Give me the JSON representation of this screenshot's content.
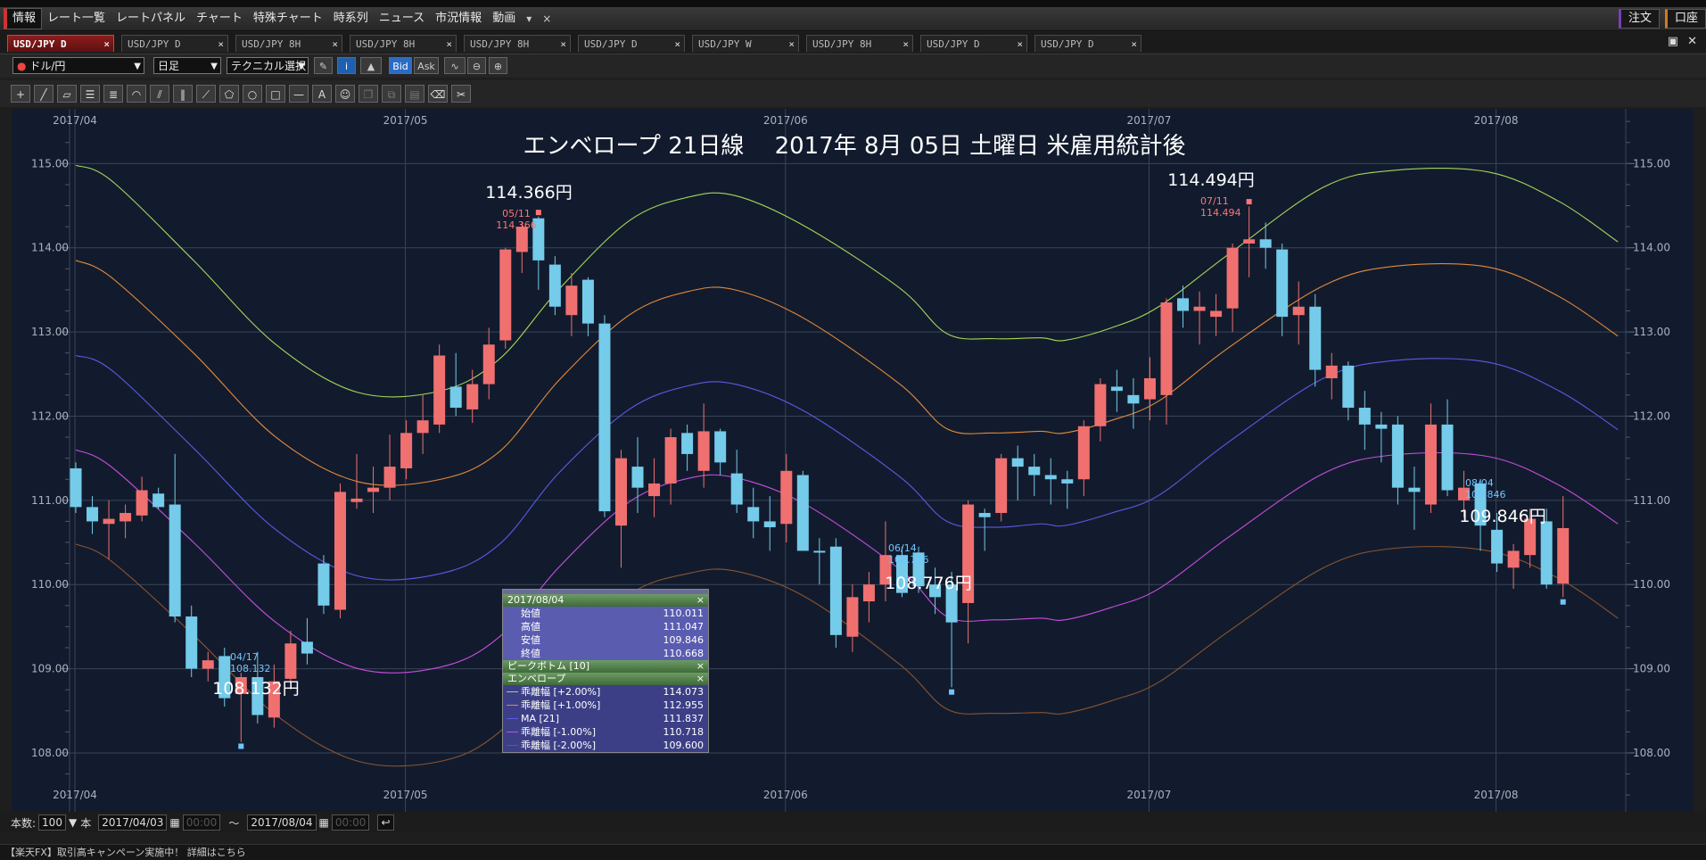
{
  "menubar": {
    "items": [
      "情報",
      "レート一覧",
      "レートパネル",
      "チャート",
      "特殊チャート",
      "時系列",
      "ニュース",
      "市況情報",
      "動画"
    ],
    "right": {
      "order": "注文",
      "account": "口座"
    }
  },
  "tabs": [
    "USD/JPY D",
    "USD/JPY D",
    "USD/JPY 8H",
    "USD/JPY 8H",
    "USD/JPY 8H",
    "USD/JPY D",
    "USD/JPY W",
    "USD/JPY 8H",
    "USD/JPY D",
    "USD/JPY D"
  ],
  "toolbar": {
    "symbol": "ドル/円",
    "timeframe": "日足",
    "technical": "テクニカル選択",
    "bid": "Bid",
    "ask": "Ask"
  },
  "chart_title": "エンベロープ 21日線　 2017年 8月 05日 土曜日 米雇用統計後",
  "annotations": {
    "may_high": "114.366円",
    "jul_high": "114.494円",
    "apr_low": "108.132円",
    "jun_low": "108.776円",
    "aug_last": "109.846円"
  },
  "markers": {
    "may_high_date": "05/11",
    "may_high_val": "114.366",
    "jul_high_date": "07/11",
    "jul_high_val": "114.494",
    "apr_low_date": "04/17",
    "apr_low_val": "108.132",
    "jun_low_date": "06/14",
    "jun_low_val": "108.776",
    "aug_date": "08/04",
    "aug_val": "109.846"
  },
  "tooltip": {
    "date": "2017/08/04",
    "ohlc": [
      {
        "label": "始値",
        "value": "110.011"
      },
      {
        "label": "高値",
        "value": "111.047"
      },
      {
        "label": "安値",
        "value": "109.846"
      },
      {
        "label": "終値",
        "value": "110.668"
      }
    ],
    "section1": "ピークボトム [10]",
    "section2": "エンベロープ",
    "env": [
      {
        "label": "乖離幅 [+2.00%]",
        "value": "114.073",
        "color": "#a5d65b"
      },
      {
        "label": "乖離幅 [+1.00%]",
        "value": "112.955",
        "color": "#e38a3a"
      },
      {
        "label": "MA [21]",
        "value": "111.837",
        "color": "#5a5ae6"
      },
      {
        "label": "乖離幅 [-1.00%]",
        "value": "110.718",
        "color": "#c64ee0"
      },
      {
        "label": "乖離幅 [-2.00%]",
        "value": "109.600",
        "color": "#8a5430"
      }
    ]
  },
  "bottom": {
    "count_label": "本数:",
    "count": "100",
    "unit": "本",
    "from": "2017/04/03",
    "time_placeholder": "00:00",
    "to": "2017/08/04",
    "tilde": "～"
  },
  "status": "【楽天FX】取引高キャンペーン実施中！ 詳細はこちら",
  "chart_data": {
    "type": "candlestick",
    "title": "エンベロープ 21日線　 2017年 8月 05日 土曜日 米雇用統計後",
    "y_ticks": [
      "115.00",
      "114.00",
      "113.00",
      "112.00",
      "111.00",
      "110.00",
      "109.00",
      "108.00"
    ],
    "ylim": [
      107.3,
      115.65
    ],
    "x_ticks": [
      {
        "label": "2017/04",
        "day": 0
      },
      {
        "label": "2017/05",
        "day": 20
      },
      {
        "label": "2017/06",
        "day": 43
      },
      {
        "label": "2017/07",
        "day": 65
      },
      {
        "label": "2017/08",
        "day": 86
      }
    ],
    "colors": {
      "up": "#f07070",
      "down": "#74cbea"
    },
    "candles": [
      [
        111.38,
        111.45,
        110.85,
        110.92
      ],
      [
        110.92,
        111.05,
        110.6,
        110.75
      ],
      [
        110.72,
        111.0,
        110.3,
        110.78
      ],
      [
        110.75,
        110.95,
        110.55,
        110.85
      ],
      [
        110.82,
        111.28,
        110.75,
        111.12
      ],
      [
        111.08,
        111.15,
        110.9,
        110.92
      ],
      [
        110.95,
        111.55,
        109.55,
        109.62
      ],
      [
        109.62,
        109.75,
        108.9,
        109.0
      ],
      [
        109.0,
        109.2,
        108.85,
        109.1
      ],
      [
        109.15,
        109.25,
        108.55,
        108.65
      ],
      [
        108.7,
        108.95,
        108.13,
        108.9
      ],
      [
        108.9,
        109.2,
        108.35,
        108.45
      ],
      [
        108.42,
        109.05,
        108.3,
        108.85
      ],
      [
        108.88,
        109.45,
        108.75,
        109.3
      ],
      [
        109.32,
        109.6,
        109.05,
        109.18
      ],
      [
        110.25,
        110.35,
        109.65,
        109.75
      ],
      [
        109.7,
        111.2,
        109.6,
        111.1
      ],
      [
        110.98,
        111.55,
        110.9,
        111.02
      ],
      [
        111.1,
        111.4,
        110.85,
        111.15
      ],
      [
        111.15,
        111.78,
        111.0,
        111.4
      ],
      [
        111.38,
        111.95,
        111.25,
        111.8
      ],
      [
        111.8,
        112.25,
        111.55,
        111.95
      ],
      [
        111.9,
        112.85,
        111.8,
        112.72
      ],
      [
        112.35,
        112.75,
        112.0,
        112.1
      ],
      [
        112.08,
        112.55,
        111.92,
        112.38
      ],
      [
        112.38,
        113.05,
        112.2,
        112.85
      ],
      [
        112.9,
        114.0,
        112.8,
        113.98
      ],
      [
        113.95,
        114.3,
        113.7,
        114.25
      ],
      [
        114.35,
        114.37,
        113.5,
        113.85
      ],
      [
        113.8,
        113.9,
        113.2,
        113.3
      ],
      [
        113.2,
        113.7,
        112.95,
        113.55
      ],
      [
        113.62,
        113.65,
        112.95,
        113.1
      ],
      [
        113.1,
        113.2,
        110.8,
        110.87
      ],
      [
        110.7,
        111.6,
        110.2,
        111.5
      ],
      [
        111.4,
        111.75,
        110.85,
        111.15
      ],
      [
        111.05,
        111.5,
        110.8,
        111.2
      ],
      [
        111.2,
        111.85,
        110.95,
        111.75
      ],
      [
        111.8,
        111.9,
        111.35,
        111.55
      ],
      [
        111.35,
        112.15,
        111.15,
        111.82
      ],
      [
        111.82,
        111.85,
        111.3,
        111.45
      ],
      [
        111.32,
        111.6,
        110.85,
        110.95
      ],
      [
        110.92,
        111.15,
        110.55,
        110.75
      ],
      [
        110.75,
        111.05,
        110.4,
        110.68
      ],
      [
        110.72,
        111.55,
        110.5,
        111.35
      ],
      [
        111.3,
        111.35,
        110.4,
        110.4
      ],
      [
        110.4,
        110.55,
        110.0,
        110.38
      ],
      [
        110.45,
        110.55,
        109.25,
        109.4
      ],
      [
        109.38,
        110.0,
        109.2,
        109.85
      ],
      [
        109.8,
        110.15,
        109.55,
        110.0
      ],
      [
        110.0,
        110.75,
        109.8,
        110.35
      ],
      [
        110.35,
        110.45,
        109.85,
        109.9
      ],
      [
        110.38,
        110.45,
        109.9,
        109.98
      ],
      [
        110.0,
        110.2,
        109.65,
        109.85
      ],
      [
        110.0,
        110.15,
        108.78,
        109.55
      ],
      [
        109.78,
        111.0,
        109.3,
        110.95
      ],
      [
        110.85,
        110.9,
        110.4,
        110.8
      ],
      [
        110.85,
        111.55,
        110.75,
        111.5
      ],
      [
        111.5,
        111.65,
        111.0,
        111.4
      ],
      [
        111.4,
        111.55,
        111.05,
        111.3
      ],
      [
        111.3,
        111.5,
        110.95,
        111.25
      ],
      [
        111.25,
        111.35,
        110.9,
        111.2
      ],
      [
        111.25,
        111.95,
        111.05,
        111.88
      ],
      [
        111.88,
        112.45,
        111.7,
        112.38
      ],
      [
        112.35,
        112.55,
        112.05,
        112.3
      ],
      [
        112.25,
        112.45,
        111.85,
        112.15
      ],
      [
        112.2,
        112.7,
        111.95,
        112.45
      ],
      [
        112.25,
        113.4,
        111.9,
        113.35
      ],
      [
        113.4,
        113.55,
        113.05,
        113.25
      ],
      [
        113.25,
        113.48,
        112.85,
        113.3
      ],
      [
        113.18,
        113.45,
        112.95,
        113.25
      ],
      [
        113.28,
        114.05,
        113.0,
        114.0
      ],
      [
        114.05,
        114.49,
        113.65,
        114.1
      ],
      [
        114.1,
        114.3,
        113.75,
        114.0
      ],
      [
        113.98,
        114.05,
        112.95,
        113.18
      ],
      [
        113.2,
        113.6,
        112.85,
        113.3
      ],
      [
        113.3,
        113.45,
        112.35,
        112.55
      ],
      [
        112.45,
        112.75,
        112.2,
        112.6
      ],
      [
        112.6,
        112.65,
        111.95,
        112.1
      ],
      [
        112.1,
        112.3,
        111.6,
        111.9
      ],
      [
        111.9,
        112.05,
        111.45,
        111.85
      ],
      [
        111.9,
        112.0,
        110.95,
        111.15
      ],
      [
        111.15,
        111.4,
        110.65,
        111.1
      ],
      [
        110.95,
        112.15,
        110.85,
        111.9
      ],
      [
        111.9,
        112.2,
        111.05,
        111.12
      ],
      [
        111.0,
        111.35,
        110.8,
        111.15
      ],
      [
        111.2,
        111.25,
        110.4,
        110.7
      ],
      [
        110.65,
        110.85,
        110.15,
        110.25
      ],
      [
        110.2,
        110.48,
        109.95,
        110.4
      ],
      [
        110.35,
        110.9,
        110.2,
        110.78
      ],
      [
        110.75,
        110.9,
        109.95,
        110.0
      ],
      [
        110.01,
        111.05,
        109.85,
        110.67
      ]
    ],
    "series": [
      {
        "name": "乖離幅 [+2.00%]",
        "color": "#a5d65b",
        "values": [
          [
            0,
            114.98
          ],
          [
            3,
            114.8
          ],
          [
            10,
            113.85
          ],
          [
            17,
            112.85
          ],
          [
            24,
            112.28
          ],
          [
            31,
            112.3
          ],
          [
            36,
            112.68
          ],
          [
            41,
            113.5
          ],
          [
            47,
            114.32
          ],
          [
            52,
            114.6
          ],
          [
            56,
            114.62
          ],
          [
            62,
            114.25
          ],
          [
            70,
            113.52
          ],
          [
            74,
            112.98
          ],
          [
            78,
            112.92
          ],
          [
            82,
            112.93
          ],
          [
            84,
            112.9
          ],
          [
            88,
            113.05
          ],
          [
            92,
            113.3
          ],
          [
            98,
            113.93
          ],
          [
            106,
            114.72
          ],
          [
            112,
            114.92
          ],
          [
            120,
            114.9
          ],
          [
            126,
            114.55
          ],
          [
            131,
            114.07
          ]
        ]
      },
      {
        "name": "乖離幅 [+1.00%]",
        "color": "#e38a3a",
        "values": [
          [
            0,
            113.85
          ],
          [
            3,
            113.65
          ],
          [
            10,
            112.75
          ],
          [
            17,
            111.75
          ],
          [
            24,
            111.22
          ],
          [
            31,
            111.25
          ],
          [
            36,
            111.58
          ],
          [
            41,
            112.42
          ],
          [
            47,
            113.2
          ],
          [
            52,
            113.48
          ],
          [
            56,
            113.5
          ],
          [
            62,
            113.15
          ],
          [
            70,
            112.38
          ],
          [
            74,
            111.85
          ],
          [
            78,
            111.8
          ],
          [
            82,
            111.82
          ],
          [
            84,
            111.8
          ],
          [
            88,
            111.95
          ],
          [
            92,
            112.18
          ],
          [
            98,
            112.82
          ],
          [
            106,
            113.55
          ],
          [
            112,
            113.78
          ],
          [
            120,
            113.77
          ],
          [
            126,
            113.42
          ],
          [
            131,
            112.95
          ]
        ]
      },
      {
        "name": "MA [21]",
        "color": "#5a5ae6",
        "values": [
          [
            0,
            112.72
          ],
          [
            3,
            112.55
          ],
          [
            10,
            111.62
          ],
          [
            17,
            110.65
          ],
          [
            24,
            110.1
          ],
          [
            31,
            110.13
          ],
          [
            36,
            110.48
          ],
          [
            41,
            111.32
          ],
          [
            47,
            112.08
          ],
          [
            52,
            112.36
          ],
          [
            56,
            112.38
          ],
          [
            62,
            112.05
          ],
          [
            70,
            111.28
          ],
          [
            74,
            110.75
          ],
          [
            78,
            110.68
          ],
          [
            82,
            110.72
          ],
          [
            84,
            110.7
          ],
          [
            88,
            110.85
          ],
          [
            92,
            111.06
          ],
          [
            98,
            111.7
          ],
          [
            106,
            112.45
          ],
          [
            112,
            112.66
          ],
          [
            120,
            112.64
          ],
          [
            126,
            112.3
          ],
          [
            131,
            111.84
          ]
        ]
      },
      {
        "name": "乖離幅 [-1.00%]",
        "color": "#c64ee0",
        "values": [
          [
            0,
            111.6
          ],
          [
            3,
            111.4
          ],
          [
            10,
            110.5
          ],
          [
            17,
            109.55
          ],
          [
            24,
            109.0
          ],
          [
            31,
            109.02
          ],
          [
            36,
            109.38
          ],
          [
            41,
            110.2
          ],
          [
            47,
            110.98
          ],
          [
            52,
            111.26
          ],
          [
            56,
            111.27
          ],
          [
            62,
            110.95
          ],
          [
            70,
            110.18
          ],
          [
            74,
            109.62
          ],
          [
            78,
            109.58
          ],
          [
            82,
            109.6
          ],
          [
            84,
            109.58
          ],
          [
            88,
            109.73
          ],
          [
            92,
            109.95
          ],
          [
            98,
            110.57
          ],
          [
            106,
            111.32
          ],
          [
            112,
            111.54
          ],
          [
            120,
            111.52
          ],
          [
            126,
            111.18
          ],
          [
            131,
            110.72
          ]
        ]
      },
      {
        "name": "乖離幅 [-2.00%]",
        "color": "#8a5430",
        "values": [
          [
            0,
            110.48
          ],
          [
            3,
            110.28
          ],
          [
            10,
            109.4
          ],
          [
            17,
            108.45
          ],
          [
            24,
            107.9
          ],
          [
            31,
            107.9
          ],
          [
            36,
            108.25
          ],
          [
            41,
            109.08
          ],
          [
            47,
            109.88
          ],
          [
            52,
            110.13
          ],
          [
            56,
            110.16
          ],
          [
            62,
            109.85
          ],
          [
            70,
            109.05
          ],
          [
            74,
            108.52
          ],
          [
            78,
            108.47
          ],
          [
            82,
            108.48
          ],
          [
            84,
            108.47
          ],
          [
            88,
            108.62
          ],
          [
            92,
            108.84
          ],
          [
            98,
            109.45
          ],
          [
            106,
            110.2
          ],
          [
            112,
            110.43
          ],
          [
            120,
            110.4
          ],
          [
            126,
            110.07
          ],
          [
            131,
            109.6
          ]
        ]
      }
    ]
  }
}
